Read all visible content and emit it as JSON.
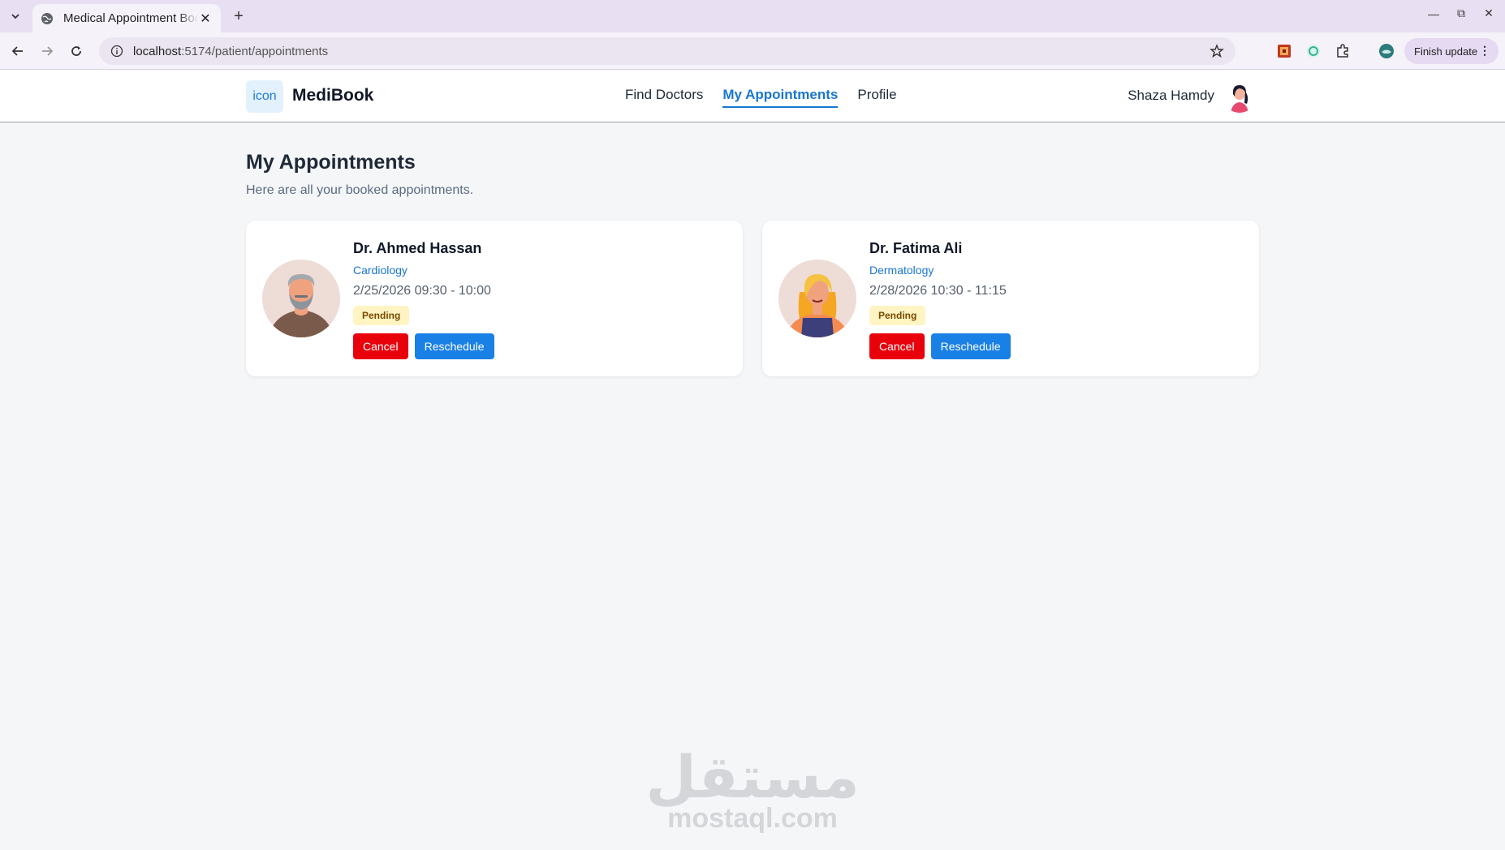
{
  "browser": {
    "tab_title": "Medical Appointment Booking",
    "url_host": "localhost",
    "url_path": ":5174/patient/appointments",
    "finish_update_label": "Finish update"
  },
  "header": {
    "logo_text": "icon",
    "brand": "MediBook",
    "nav": [
      {
        "label": "Find Doctors",
        "active": false
      },
      {
        "label": "My Appointments",
        "active": true
      },
      {
        "label": "Profile",
        "active": false
      }
    ],
    "user_name": "Shaza Hamdy"
  },
  "page": {
    "title": "My Appointments",
    "subtitle": "Here are all your booked appointments."
  },
  "appointments": [
    {
      "doctor": "Dr. Ahmed Hassan",
      "specialty": "Cardiology",
      "datetime": "2/25/2026 09:30 - 10:00",
      "status": "Pending",
      "cancel_label": "Cancel",
      "reschedule_label": "Reschedule"
    },
    {
      "doctor": "Dr. Fatima Ali",
      "specialty": "Dermatology",
      "datetime": "2/28/2026 10:30 - 11:15",
      "status": "Pending",
      "cancel_label": "Cancel",
      "reschedule_label": "Reschedule"
    }
  ],
  "watermark": {
    "arabic": "مستقل",
    "latin": "mostaql.com"
  },
  "colors": {
    "primary": "#1976d2",
    "cancel": "#e8000b",
    "reschedule": "#1980e6",
    "pending_bg": "#fff4c2",
    "pending_text": "#7a4a00"
  },
  "icons": [
    "tab-list-icon",
    "globe-icon",
    "close-icon",
    "new-tab-icon",
    "minimize-icon",
    "maximize-icon",
    "window-close-icon",
    "back-icon",
    "forward-icon",
    "reload-icon",
    "info-icon",
    "star-icon",
    "extension-icon",
    "profile-icon",
    "menu-icon"
  ]
}
